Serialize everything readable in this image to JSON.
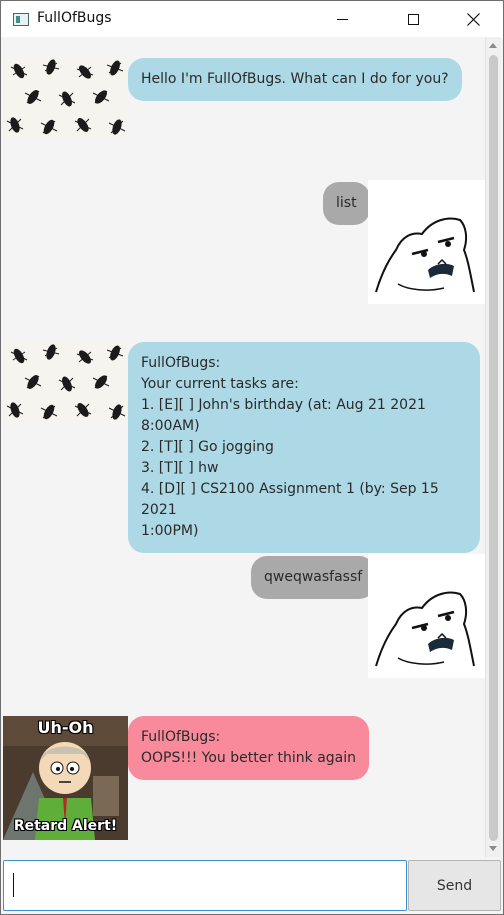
{
  "window": {
    "title": "FullOfBugs"
  },
  "messages": [
    {
      "sender": "bot",
      "text": "Hello I'm FullOfBugs. What can I do for you?"
    },
    {
      "sender": "user",
      "text": "list"
    },
    {
      "sender": "bot",
      "text": "FullOfBugs:\nYour current tasks are:\n1. [E][ ] John's birthday (at: Aug 21 2021 8:00AM)\n2. [T][ ] Go jogging\n3. [T][ ] hw\n4. [D][ ] CS2100 Assignment 1 (by: Sep 15 2021\n1:00PM)"
    },
    {
      "sender": "user",
      "text": "qweqwasfassf"
    },
    {
      "sender": "bot-error",
      "text": "FullOfBugs:\nOOPS!!! You better think again"
    }
  ],
  "avatar_texts": {
    "alert_top": "Uh-Oh",
    "alert_bottom": "Retard Alert!"
  },
  "input": {
    "value": "",
    "send_label": "Send"
  },
  "colors": {
    "bot_bubble": "#add8e6",
    "user_bubble": "#a9a9a9",
    "error_bubble": "#f98a9b",
    "input_focus": "#3c8fd1"
  }
}
